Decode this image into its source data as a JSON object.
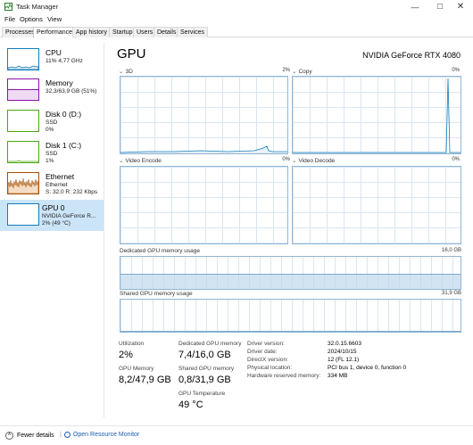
{
  "window": {
    "title": "Task Manager"
  },
  "menu": [
    "File",
    "Options",
    "View"
  ],
  "tabs": [
    "Processes",
    "Performance",
    "App history",
    "Startup",
    "Users",
    "Details",
    "Services"
  ],
  "sidebar": [
    {
      "title": "CPU",
      "sub1": "11% 4,77 GHz",
      "sub2": "",
      "color": "#117dbb",
      "fill": "#f1f6fa",
      "level": 0.11
    },
    {
      "title": "Memory",
      "sub1": "32,3/63,9 GB (51%)",
      "sub2": "",
      "color": "#8b12ae",
      "fill": "#f4e9f7",
      "level": 0.51
    },
    {
      "title": "Disk 0 (D:)",
      "sub1": "SSD",
      "sub2": "0%",
      "color": "#4da60c",
      "fill": "#eff7e9",
      "level": 0.0
    },
    {
      "title": "Disk 1 (C:)",
      "sub1": "SSD",
      "sub2": "1%",
      "color": "#4da60c",
      "fill": "#eff7e9",
      "level": 0.01
    },
    {
      "title": "Ethernet",
      "sub1": "Ethernet",
      "sub2": "S: 32,0  R: 232 Kbps",
      "color": "#a74f01",
      "fill": "#fcf3eb",
      "level": 0.5
    },
    {
      "title": "GPU 0",
      "sub1": "NVIDIA GeForce R...",
      "sub2": "2% (49 °C)",
      "color": "#117dbb",
      "fill": "#f1f6fa",
      "level": 0.02
    }
  ],
  "gpu": {
    "title": "GPU",
    "model": "NVIDIA GeForce RTX 4080",
    "engines": [
      {
        "name": "3D",
        "pct": "2%",
        "max": "100%"
      },
      {
        "name": "Copy",
        "pct": "0%",
        "max": "100%"
      },
      {
        "name": "Video Encode",
        "pct": "0%",
        "max": "100%"
      },
      {
        "name": "Video Decode",
        "pct": "0%",
        "max": "100%"
      }
    ],
    "dedicated_label": "Dedicated GPU memory usage",
    "dedicated_max": "16,0 GB",
    "dedicated_fraction": 0.4625,
    "shared_label": "Shared GPU memory usage",
    "shared_max": "31,9 GB",
    "shared_fraction": 0.025
  },
  "stats": {
    "utilization_label": "Utilization",
    "utilization": "2%",
    "gpu_memory_label": "GPU Memory",
    "gpu_memory": "8,2/47,9 GB",
    "dedicated_label": "Dedicated GPU memory",
    "dedicated": "7,4/16,0 GB",
    "shared_label": "Shared GPU memory",
    "shared": "0,8/31,9 GB",
    "temp_label": "GPU Temperature",
    "temp": "49 °C"
  },
  "info": [
    {
      "key": "Driver version:",
      "value": "32.0.15.6603"
    },
    {
      "key": "Driver date:",
      "value": "2024/10/15"
    },
    {
      "key": "DirectX version:",
      "value": "12 (FL 12.1)"
    },
    {
      "key": "Physical location:",
      "value": "PCI bus 1, device 0, function 0"
    },
    {
      "key": "Hardware reserved memory:",
      "value": "334 MB"
    }
  ],
  "footer": {
    "fewer_details": "Fewer details",
    "resource_monitor": "Open Resource Monitor"
  }
}
